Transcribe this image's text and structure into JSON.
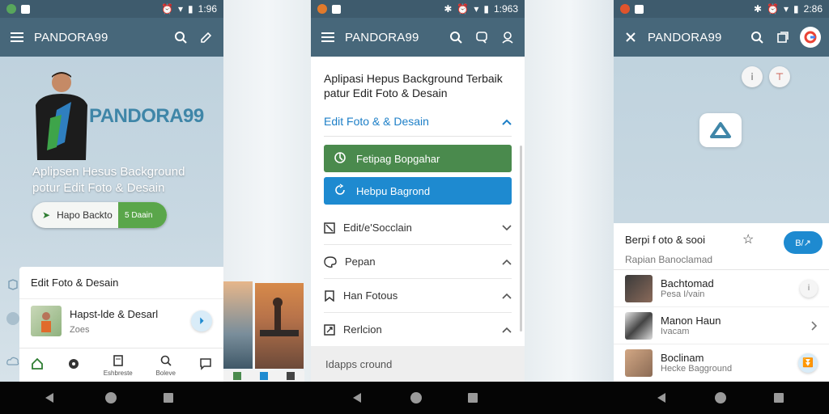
{
  "phone1": {
    "status": {
      "time": "1:96"
    },
    "appbar": {
      "title": "PANDORA99"
    },
    "hero": {
      "brand": "PANDORA99",
      "line1": "Aplipsen Hesus Background",
      "line2": "potur Edit Foto & Desain",
      "pill_left": "Hapo Backto",
      "pill_right": "5 Daain"
    },
    "sheet": {
      "header": "Edit Foto & Desain",
      "item_title": "Hapst-lde & Desarl",
      "item_sub": "Zoes"
    },
    "tabs": [
      {
        "label": ""
      },
      {
        "label": ""
      },
      {
        "label": "Eshbreste"
      },
      {
        "label": "Boleve"
      },
      {
        "label": ""
      }
    ]
  },
  "phone2": {
    "status": {
      "time": "1:963"
    },
    "appbar": {
      "title": "PANDORA99"
    },
    "heading_line1": "Aplipasi Hepus Background Terbaik",
    "heading_line2": "patur Edit Foto & Desain",
    "section": "Edit Foto & & Desain",
    "btn_green": "Fetipag Bopgahar",
    "btn_blue": "Hebpu Bagrond",
    "rows": [
      {
        "label": "Edit/e'Socclain"
      },
      {
        "label": "Pepan"
      },
      {
        "label": "Han Fotous"
      },
      {
        "label": "Rerlcion"
      }
    ],
    "footer": "Idapps cround"
  },
  "phone3": {
    "status": {
      "time": "2:86"
    },
    "appbar": {
      "title": "PANDORA99"
    },
    "sheet_title": "Berpi f oto & sooi",
    "sheet_sub": "Rapian Banoclamad",
    "fab": "B/↗",
    "items": [
      {
        "title": "Bachtomad",
        "sub": "Pesa I/vain"
      },
      {
        "title": "Manon Haun",
        "sub": "Ivacam"
      },
      {
        "title": "Boclinam",
        "sub": "Hecke Bagground"
      }
    ]
  },
  "colors": {
    "appbar": "#47677a",
    "brand_blue": "#3f86a8",
    "green": "#4a8a4d",
    "blue": "#1e8ad0"
  }
}
